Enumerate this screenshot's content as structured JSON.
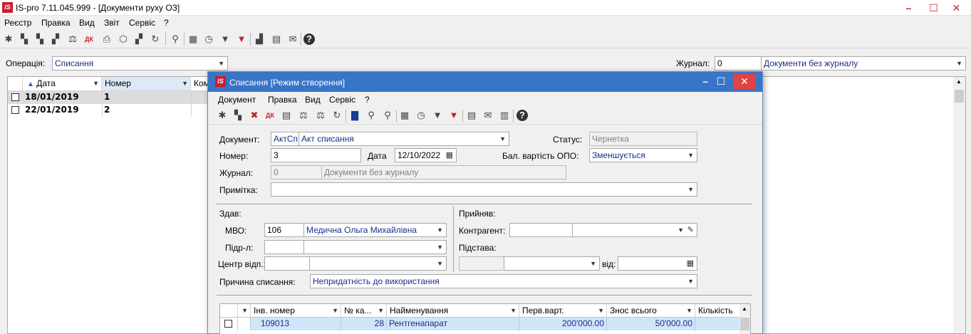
{
  "window": {
    "title": "IS-pro 7.11.045.999 - [Документи руху ОЗ]",
    "logo": "IS"
  },
  "menu": [
    "Реєстр",
    "Правка",
    "Вид",
    "Звіт",
    "Сервіс",
    "?"
  ],
  "filter": {
    "operation_label": "Операція:",
    "operation_value": "Списання",
    "journal_label": "Журнал:",
    "journal_code": "0",
    "journal_name": "Документи без журналу"
  },
  "list": {
    "columns": [
      "Дата",
      "Номер",
      "Комe"
    ],
    "rows": [
      {
        "date": "18/01/2019",
        "number": "1"
      },
      {
        "date": "22/01/2019",
        "number": "2"
      }
    ]
  },
  "dialog": {
    "logo": "IS",
    "title": "Списання [Режим створення]",
    "menu": [
      "Документ",
      "Правка",
      "Вид",
      "Сервіс",
      "?"
    ],
    "document_label": "Документ:",
    "document_code": "АктСп",
    "document_name": "Акт списання",
    "status_label": "Статус:",
    "status_value": "Чернетка",
    "number_label": "Номер:",
    "number_value": "3",
    "date_label": "Дата",
    "date_value": "12/10/2022",
    "bal_label": "Бал. вартість ОПО:",
    "bal_value": "Зменшується",
    "journal_label": "Журнал:",
    "journal_code": "0",
    "journal_name": "Документи без журналу",
    "note_label": "Примітка:",
    "gave_label": "Здав:",
    "mvo_label": "МВО:",
    "mvo_code": "106",
    "mvo_name": "Медична Ольга Михайлівна",
    "dept_label": "Підр-л:",
    "center_label": "Центр відп.:",
    "received_label": "Прийняв:",
    "contractor_label": "Контрагент:",
    "basis_label": "Підстава:",
    "from_label": "від:",
    "reason_label": "Причина списання:",
    "reason_value": "Непридатність до використання",
    "grid": {
      "columns": [
        "Інв. номер",
        "№ ка...",
        "Найменування",
        "Перв.варт.",
        "Знос всього",
        "Кількість"
      ],
      "rows": [
        {
          "inv": "109013",
          "card": "28",
          "name": "Рентгенапарат",
          "cost": "200'000.00",
          "wear": "50'000.00",
          "qty": ""
        }
      ]
    }
  }
}
